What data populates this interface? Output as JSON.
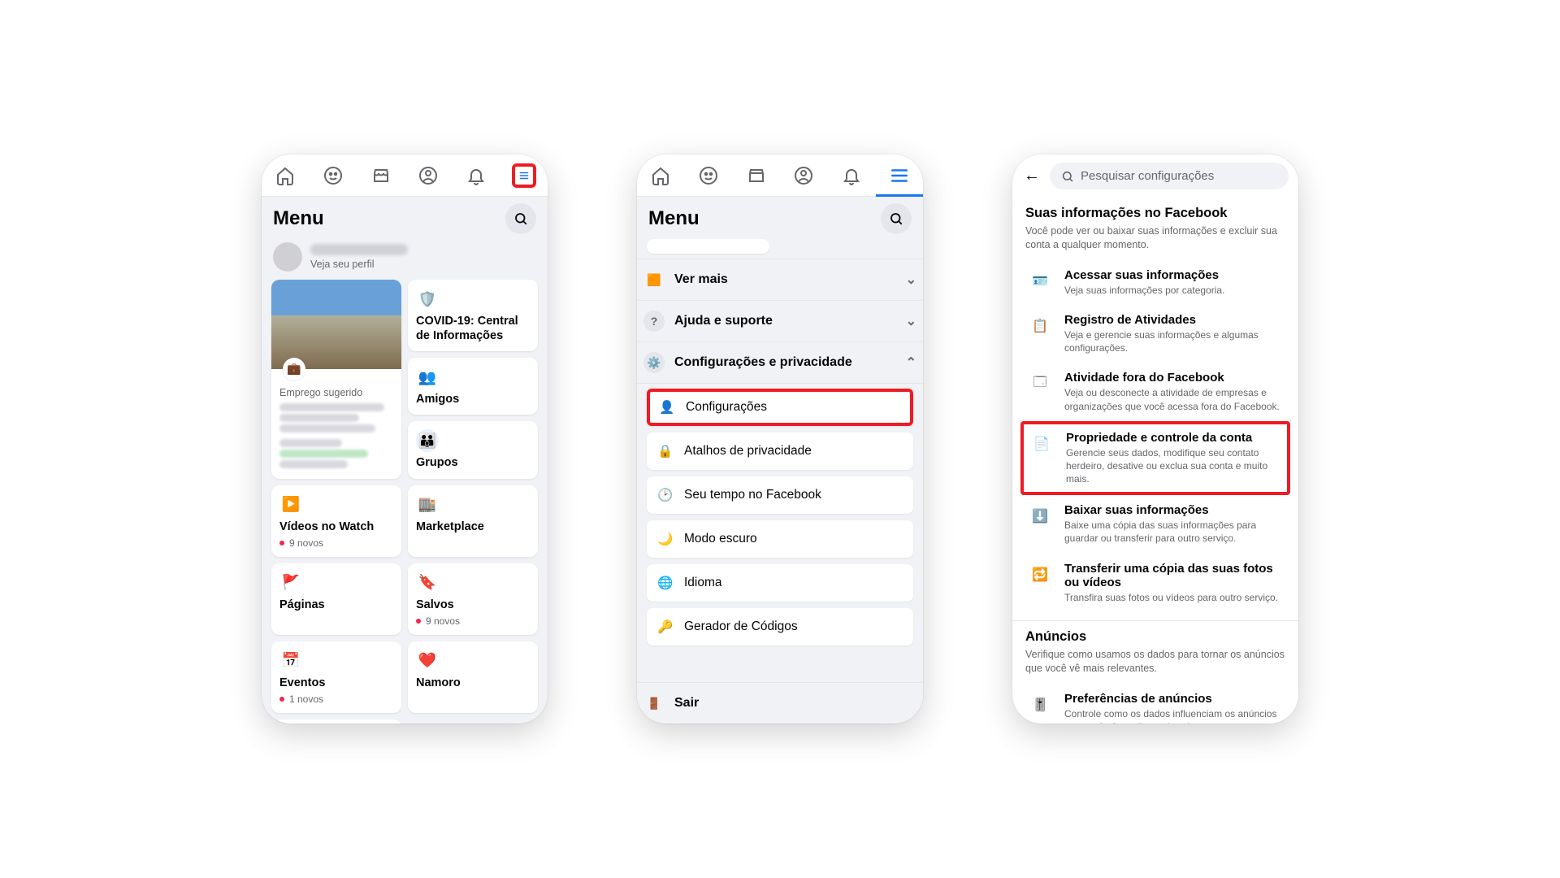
{
  "topnav_icons": [
    "home",
    "friends",
    "marketplace",
    "profile",
    "bell",
    "menu"
  ],
  "screen1": {
    "menu_title": "Menu",
    "profile_sub": "Veja seu perfil",
    "suggested_title": "Emprego sugerido",
    "cards": {
      "covid": "COVID-19: Central de Informações",
      "amigos": "Amigos",
      "grupos": "Grupos",
      "videos": "Vídeos no Watch",
      "videos_sub": "9 novos",
      "marketplace": "Marketplace",
      "paginas": "Páginas",
      "salvos": "Salvos",
      "salvos_sub": "9 novos",
      "eventos": "Eventos",
      "eventos_sub": "1 novos",
      "namoro": "Namoro"
    }
  },
  "screen2": {
    "menu_title": "Menu",
    "ver_mais": "Ver mais",
    "ajuda": "Ajuda e suporte",
    "config_priv": "Configurações e privacidade",
    "items": {
      "configuracoes": "Configurações",
      "atalhos": "Atalhos de privacidade",
      "tempo": "Seu tempo no Facebook",
      "escuro": "Modo escuro",
      "idioma": "Idioma",
      "gerador": "Gerador de Códigos"
    },
    "sair": "Sair"
  },
  "screen3": {
    "search_placeholder": "Pesquisar configurações",
    "sec1_title": "Suas informações no Facebook",
    "sec1_desc": "Você pode ver ou baixar suas informações e excluir sua conta a qualquer momento.",
    "items": [
      {
        "t": "Acessar suas informações",
        "d": "Veja suas informações por categoria."
      },
      {
        "t": "Registro de Atividades",
        "d": "Veja e gerencie suas informações e algumas configurações."
      },
      {
        "t": "Atividade fora do Facebook",
        "d": "Veja ou desconecte a atividade de empresas e organizações que você acessa fora do Facebook."
      },
      {
        "t": "Propriedade e controle da conta",
        "d": "Gerencie seus dados, modifique seu contato herdeiro, desative ou exclua sua conta e muito mais."
      },
      {
        "t": "Baixar suas informações",
        "d": "Baixe uma cópia das suas informações para guardar ou transferir para outro serviço."
      },
      {
        "t": "Transferir uma cópia das suas fotos ou vídeos",
        "d": "Transfira suas fotos ou vídeos para outro serviço."
      }
    ],
    "sec2_title": "Anúncios",
    "sec2_desc": "Verifique como usamos os dados para tornar os anúncios que você vê mais relevantes.",
    "ad_item_t": "Preferências de anúncios",
    "ad_item_d": "Controle como os dados influenciam os anúncios que você vê e saiba mais sobre como nossos anúncios funcionam."
  }
}
